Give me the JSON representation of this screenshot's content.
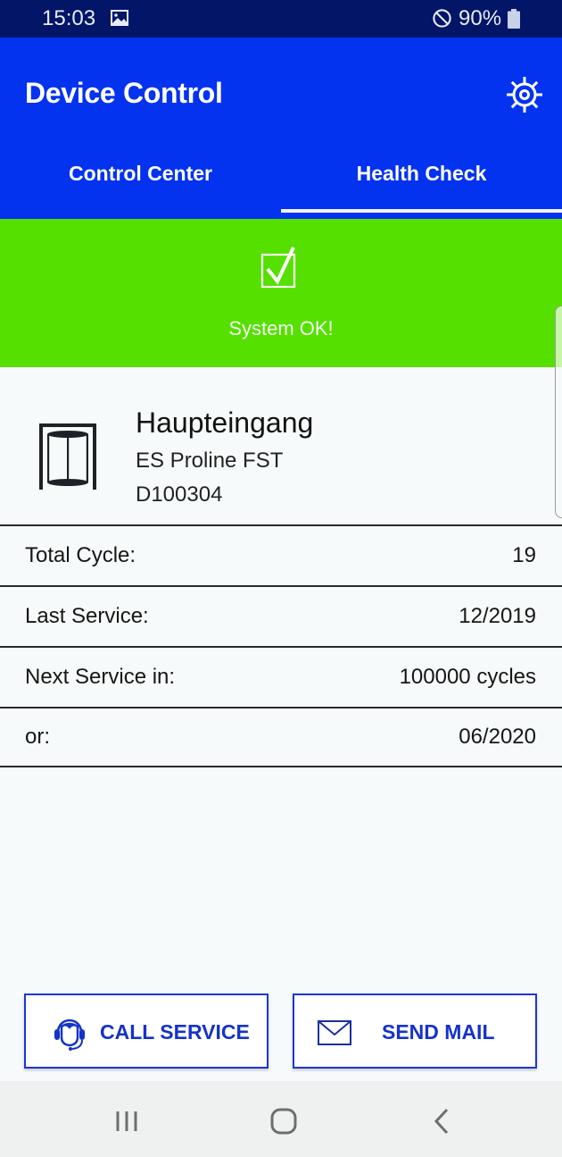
{
  "status_bar": {
    "time": "15:03",
    "notification_icon": "image-icon",
    "dnd_icon": "do-not-disturb-icon",
    "battery_percent": "90%",
    "battery_icon": "battery-icon"
  },
  "app_bar": {
    "title": "Device Control",
    "settings_icon": "gear-icon"
  },
  "tabs": [
    {
      "label": "Control Center",
      "selected": false
    },
    {
      "label": "Health Check",
      "selected": true
    }
  ],
  "health_status": {
    "icon": "checkbox-checked-icon",
    "text": "System OK!",
    "color": "#55e000"
  },
  "device": {
    "icon": "revolving-door-icon",
    "name": "Haupteingang",
    "model": "ES Proline FST",
    "id": "D100304"
  },
  "info_rows": [
    {
      "label": "Total Cycle:",
      "value": "19"
    },
    {
      "label": "Last Service:",
      "value": "12/2019"
    },
    {
      "label": "Next Service in:",
      "value": "100000 cycles"
    },
    {
      "label": "or:",
      "value": "06/2020"
    }
  ],
  "actions": {
    "call_service": {
      "label": "CALL SERVICE",
      "icon": "headset-icon"
    },
    "send_mail": {
      "label": "SEND MAIL",
      "icon": "envelope-icon"
    }
  },
  "nav_bar": {
    "recents_icon": "recents-icon",
    "home_icon": "home-icon",
    "back_icon": "back-icon"
  },
  "colors": {
    "app_bar": "#0433f0",
    "status_bar": "#021566",
    "accent": "#1533c8",
    "ok_green": "#55e000"
  }
}
